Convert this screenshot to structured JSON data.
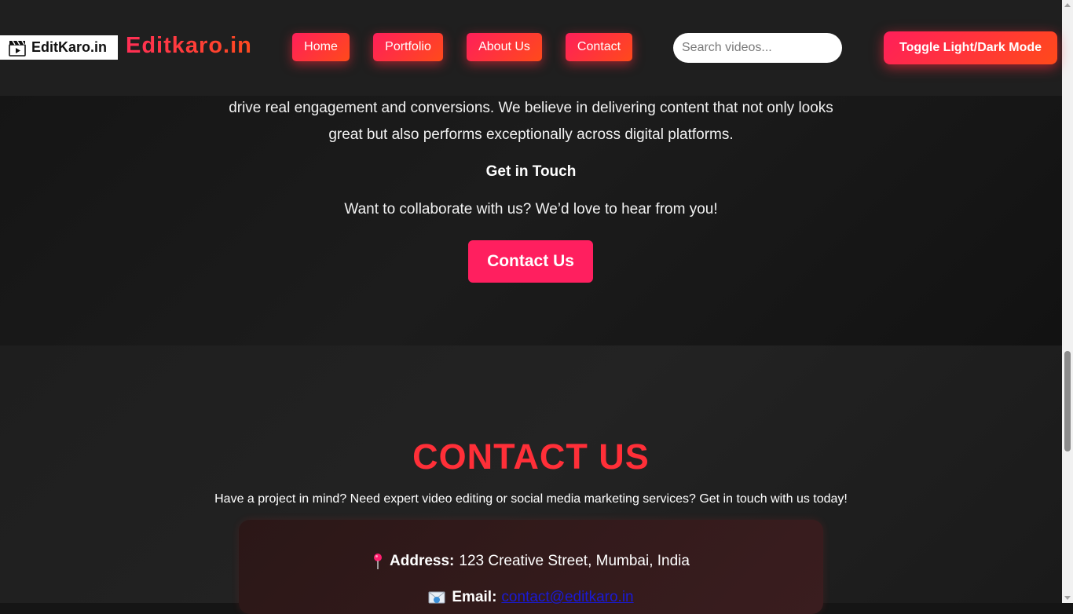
{
  "header": {
    "logo_text": "EditKaro.in",
    "logo_icon": "clapperboard-icon",
    "brand": "Editkaro.in",
    "nav": [
      {
        "label": "Home"
      },
      {
        "label": "Portfolio"
      },
      {
        "label": "About Us"
      },
      {
        "label": "Contact"
      }
    ],
    "search_placeholder": "Search videos...",
    "toggle_label": "Toggle Light/Dark Mode"
  },
  "about": {
    "paragraph": "drive real engagement and conversions. We believe in delivering content that not only looks great but also performs exceptionally across digital platforms.",
    "get_in_touch": "Get in Touch",
    "collab_text": "Want to collaborate with us? We’d love to hear from you!",
    "contact_button": "Contact Us"
  },
  "contact": {
    "title": "CONTACT US",
    "subtitle": "Have a project in mind? Need expert video editing or social media marketing services? Get in touch with us today!",
    "address_icon": "pushpin-icon",
    "address_label": "Address:",
    "address_value": "123 Creative Street, Mumbai, India",
    "email_icon": "envelope-icon",
    "email_label": "Email:",
    "email_value": "contact@editkaro.in"
  },
  "colors": {
    "accent": "#ff1f5f",
    "accent_orange": "#ff4a1a",
    "title_red": "#ff2f38",
    "background": "#151515"
  }
}
